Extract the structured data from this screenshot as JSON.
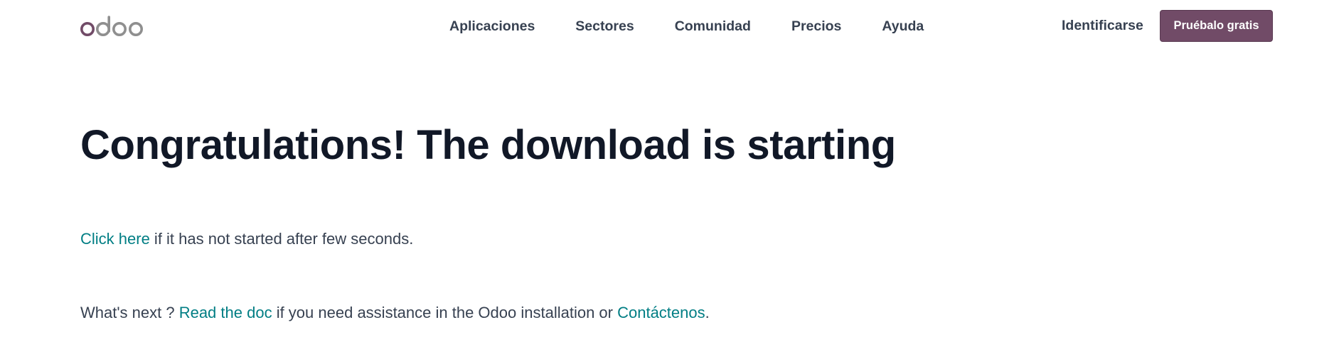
{
  "header": {
    "logo_text": "odoo",
    "nav": [
      {
        "label": "Aplicaciones"
      },
      {
        "label": "Sectores"
      },
      {
        "label": "Comunidad"
      },
      {
        "label": "Precios"
      },
      {
        "label": "Ayuda"
      }
    ],
    "signin_label": "Identificarse",
    "cta_label": "Pruébalo gratis"
  },
  "main": {
    "title": "Congratulations! The download is starting",
    "line1": {
      "link_label": "Click here",
      "text": " if it has not started after few seconds."
    },
    "line2": {
      "prefix": "What's next ? ",
      "doc_link_label": "Read the doc",
      "middle": " if you need assistance in the Odoo installation or ",
      "contact_link_label": "Contáctenos",
      "suffix": "."
    }
  },
  "colors": {
    "brand": "#714b67",
    "link": "#017e84",
    "heading": "#111827",
    "text": "#374151",
    "logo_grey": "#8f8f8f"
  },
  "icons": {
    "logo": "odoo-logo"
  }
}
